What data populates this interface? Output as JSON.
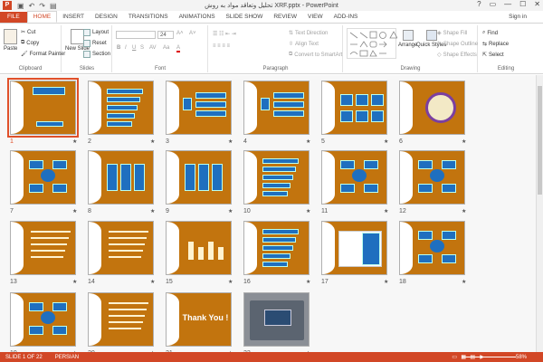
{
  "window": {
    "title": "تحلیل وتعاقد مواد به روش XRF.pptx - PowerPoint",
    "app_icon": "P",
    "controls": [
      "?",
      "▭",
      "—",
      "☐",
      "✕"
    ]
  },
  "quick_access": [
    "save-icon",
    "undo-icon",
    "redo-icon",
    "start-icon"
  ],
  "ribbon_tabs": [
    "FILE",
    "HOME",
    "INSERT",
    "DESIGN",
    "TRANSITIONS",
    "ANIMATIONS",
    "SLIDE SHOW",
    "REVIEW",
    "VIEW",
    "ADD-INS"
  ],
  "active_tab": "HOME",
  "signin": "Sign in",
  "clipboard": {
    "label": "Clipboard",
    "paste": "Paste",
    "cut": "Cut",
    "copy": "Copy",
    "format_painter": "Format Painter"
  },
  "slides_group": {
    "label": "Slides",
    "new_slide": "New Slide",
    "layout": "Layout",
    "reset": "Reset",
    "section": "Section"
  },
  "font_group": {
    "label": "Font",
    "font_size": "24",
    "bold": "B",
    "italic": "I",
    "underline": "U",
    "strike": "S",
    "char_spacing": "AV",
    "case": "Aa",
    "font_color": "A"
  },
  "paragraph_group": {
    "label": "Paragraph",
    "text_direction": "Text Direction",
    "align_text": "Align Text",
    "convert_smartart": "Convert to SmartArt"
  },
  "drawing_group": {
    "label": "Drawing",
    "arrange": "Arrange",
    "quick_styles": "Quick Styles",
    "shape_fill": "Shape Fill",
    "shape_outline": "Shape Outline",
    "shape_effects": "Shape Effects"
  },
  "editing_group": {
    "label": "Editing",
    "find": "Find",
    "replace": "Replace",
    "select": "Select"
  },
  "slides": [
    {
      "num": "1",
      "style": "title",
      "selected": true
    },
    {
      "num": "2",
      "style": "list"
    },
    {
      "num": "3",
      "style": "boxes"
    },
    {
      "num": "4",
      "style": "boxes"
    },
    {
      "num": "5",
      "style": "grid"
    },
    {
      "num": "6",
      "style": "circle"
    },
    {
      "num": "7",
      "style": "diagram"
    },
    {
      "num": "8",
      "style": "columns"
    },
    {
      "num": "9",
      "style": "columns"
    },
    {
      "num": "10",
      "style": "list"
    },
    {
      "num": "11",
      "style": "diagram"
    },
    {
      "num": "12",
      "style": "diagram"
    },
    {
      "num": "13",
      "style": "text"
    },
    {
      "num": "14",
      "style": "text"
    },
    {
      "num": "15",
      "style": "chart"
    },
    {
      "num": "16",
      "style": "list"
    },
    {
      "num": "17",
      "style": "table"
    },
    {
      "num": "18",
      "style": "diagram"
    },
    {
      "num": "19",
      "style": "diagram"
    },
    {
      "num": "20",
      "style": "text"
    },
    {
      "num": "21",
      "style": "thanks",
      "text": "Thank You !"
    },
    {
      "num": "22",
      "style": "photo"
    }
  ],
  "status": {
    "slide_info": "SLIDE 1 OF 22",
    "language": "PERSIAN",
    "zoom": "58%"
  },
  "colors": {
    "accent": "#d24726",
    "slide_bg": "#c2740e",
    "box": "#1f6fbf"
  }
}
